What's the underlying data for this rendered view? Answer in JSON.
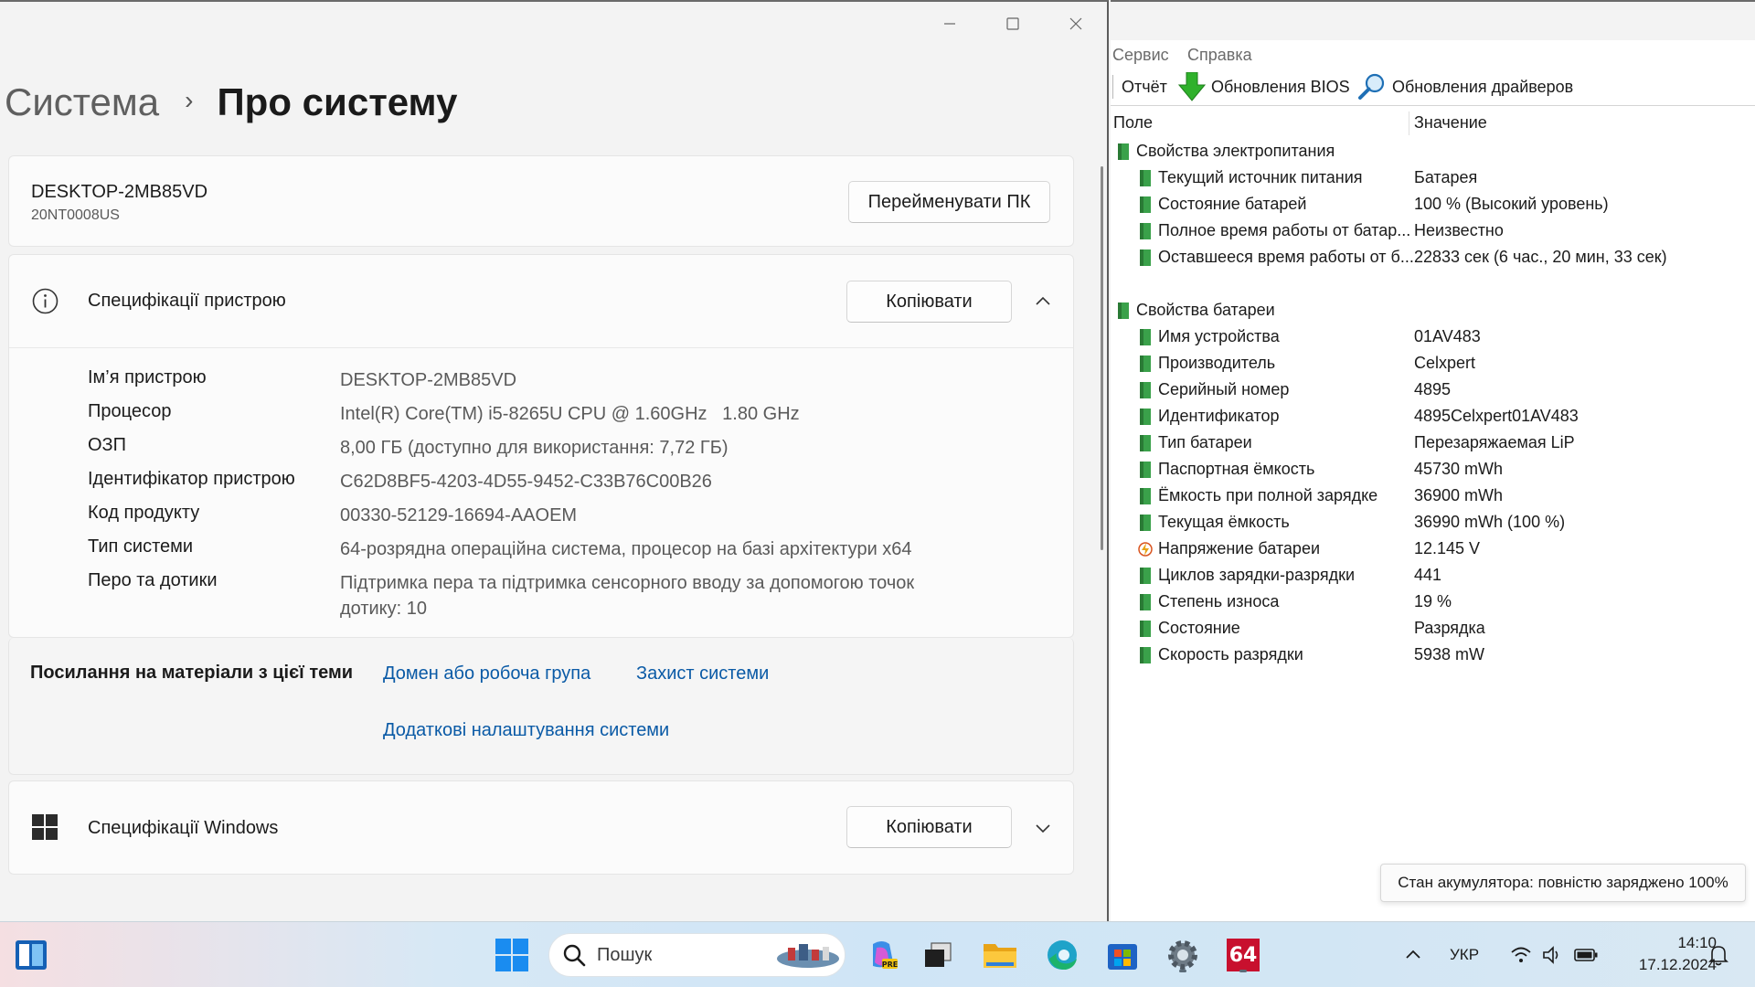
{
  "settings": {
    "breadcrumb": {
      "parent": "Система",
      "current": "Про систему"
    },
    "pc": {
      "name": "DESKTOP-2MB85VD",
      "model": "20NT0008US",
      "rename_label": "Перейменувати ПК"
    },
    "device_specs": {
      "title": "Специфікації пристрою",
      "copy_label": "Копіювати",
      "rows": [
        {
          "key": "Ім’я пристрою",
          "value": "DESKTOP-2MB85VD"
        },
        {
          "key": "Процесор",
          "value": "Intel(R) Core(TM) i5-8265U CPU @ 1.60GHz   1.80 GHz"
        },
        {
          "key": "ОЗП",
          "value": "8,00 ГБ (доступно для використання: 7,72 ГБ)"
        },
        {
          "key": "Ідентифікатор пристрою",
          "value": "C62D8BF5-4203-4D55-9452-C33B76C00B26"
        },
        {
          "key": "Код продукту",
          "value": "00330-52129-16694-AAOEM"
        },
        {
          "key": "Тип системи",
          "value": "64-розрядна операційна система, процесор на базі архітектури x64"
        },
        {
          "key": "Перо та дотики",
          "value": "Підтримка пера та підтримка сенсорного вводу за допомогою точок дотику: 10"
        }
      ]
    },
    "links": {
      "label": "Посилання на матеріали з цієї теми",
      "domain": "Домен або робоча група",
      "protection": "Захист системи",
      "advanced": "Додаткові налаштування системи"
    },
    "windows_specs": {
      "title": "Специфікації Windows",
      "copy_label": "Копіювати"
    }
  },
  "aida": {
    "menu": {
      "service": "Сервис",
      "help": "Справка"
    },
    "toolbar": {
      "report": "Отчёт",
      "bios": "Обновления BIOS",
      "drivers": "Обновления драйверов"
    },
    "columns": {
      "field": "Поле",
      "value": "Значение"
    },
    "power_group": "Свойства электропитания",
    "power_rows": [
      {
        "field": "Текущий источник питания",
        "value": "Батарея"
      },
      {
        "field": "Состояние батарей",
        "value": "100 % (Высокий уровень)"
      },
      {
        "field": "Полное время работы от батар...",
        "value": "Неизвестно"
      },
      {
        "field": "Оставшееся время работы от б...",
        "value": "22833 сек (6 час., 20 мин, 33 сек)"
      }
    ],
    "battery_group": "Свойства батареи",
    "battery_rows": [
      {
        "field": "Имя устройства",
        "value": "01AV483"
      },
      {
        "field": "Производитель",
        "value": "Celxpert"
      },
      {
        "field": "Серийный номер",
        "value": "4895"
      },
      {
        "field": "Идентификатор",
        "value": "4895Celxpert01AV483"
      },
      {
        "field": "Тип батареи",
        "value": "Перезаряжаемая LiP"
      },
      {
        "field": "Паспортная ёмкость",
        "value": "45730 mWh"
      },
      {
        "field": "Ёмкость при полной зарядке",
        "value": "36900 mWh"
      },
      {
        "field": "Текущая ёмкость",
        "value": "36990 mWh  (100 %)"
      },
      {
        "field": "Напряжение батареи",
        "value": "12.145 V"
      },
      {
        "field": "Циклов зарядки-разрядки",
        "value": "441"
      },
      {
        "field": "Степень износа",
        "value": "19 %"
      },
      {
        "field": "Состояние",
        "value": "Разрядка"
      },
      {
        "field": "Скорость разрядки",
        "value": "5938 mW"
      }
    ]
  },
  "tooltip": "Стан акумулятора: повністю заряджено 100%",
  "taskbar": {
    "search_placeholder": "Пошук",
    "aida_badge": "64",
    "language": "УКР",
    "time": "14:10",
    "date": "17.12.2024"
  },
  "colors": {
    "link": "#0a5aa6",
    "aida_green_icon": "#3aa14a",
    "aida_badge": "#c8102e",
    "windows_blue": "#1a8cf0"
  }
}
